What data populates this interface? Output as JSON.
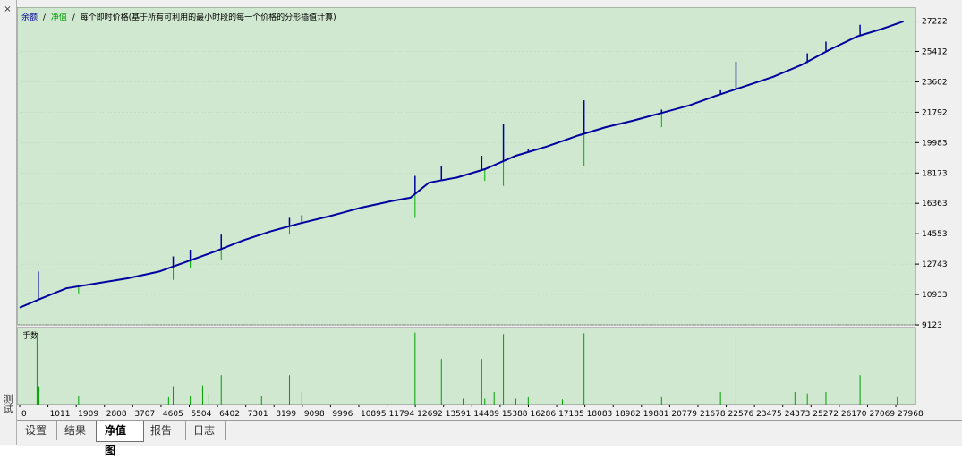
{
  "window": {
    "side_title": "测试",
    "close_glyph": "×"
  },
  "tabs": [
    {
      "label": "设置",
      "active": false
    },
    {
      "label": "结果",
      "active": false
    },
    {
      "label": "净值图",
      "active": true
    },
    {
      "label": "报告",
      "active": false
    },
    {
      "label": "日志",
      "active": false
    }
  ],
  "chart_data": [
    {
      "type": "line",
      "header": {
        "balance_label": "余额",
        "separator": "/",
        "equity_label": "净值",
        "note": "每个即时价格(基于所有可利用的最小时段的每一个价格的分形插值计算)"
      },
      "y_ticks": [
        27222,
        25412,
        23602,
        21792,
        19983,
        18173,
        16363,
        14553,
        12743,
        10933,
        9123
      ],
      "ylim": [
        9123,
        28050
      ],
      "xlim": [
        0,
        28800
      ],
      "colors": {
        "balance": "#0000a0",
        "equity": "#00b000",
        "background": "#cfe8cf",
        "grid": "#b4ccb4"
      },
      "series": [
        {
          "name": "余额",
          "x": [
            0,
            700,
            1500,
            2500,
            3500,
            4500,
            5400,
            6300,
            7200,
            8100,
            9000,
            10000,
            11000,
            12000,
            12600,
            13200,
            14100,
            15000,
            16000,
            17000,
            18000,
            18900,
            19800,
            20700,
            21600,
            22500,
            23400,
            24300,
            25200,
            26100,
            27000,
            27800,
            28500
          ],
          "y": [
            10150,
            10700,
            11300,
            11600,
            11900,
            12300,
            12900,
            13500,
            14150,
            14700,
            15150,
            15600,
            16100,
            16500,
            16700,
            17600,
            17900,
            18400,
            19200,
            19750,
            20400,
            20900,
            21300,
            21750,
            22200,
            22800,
            23350,
            23900,
            24600,
            25500,
            26300,
            26750,
            27200
          ]
        },
        {
          "name": "净值",
          "spikes": [
            {
              "x": 600,
              "y": 12300
            },
            {
              "x": 1900,
              "y": 11500
            },
            {
              "x": 4950,
              "y": 13200
            },
            {
              "x": 5500,
              "y": 13600
            },
            {
              "x": 6500,
              "y": 14500
            },
            {
              "x": 8700,
              "y": 15500
            },
            {
              "x": 9100,
              "y": 15650
            },
            {
              "x": 12750,
              "y": 18000
            },
            {
              "x": 13600,
              "y": 18600
            },
            {
              "x": 14900,
              "y": 19200
            },
            {
              "x": 15600,
              "y": 21100
            },
            {
              "x": 16400,
              "y": 19600
            },
            {
              "x": 18200,
              "y": 22500
            },
            {
              "x": 20700,
              "y": 21950
            },
            {
              "x": 22600,
              "y": 23100
            },
            {
              "x": 23100,
              "y": 24800
            },
            {
              "x": 25400,
              "y": 25300
            },
            {
              "x": 26000,
              "y": 26000
            },
            {
              "x": 27100,
              "y": 27000
            }
          ],
          "dips": [
            {
              "x": 1900,
              "y": 11000
            },
            {
              "x": 4950,
              "y": 11800
            },
            {
              "x": 5500,
              "y": 12500
            },
            {
              "x": 6500,
              "y": 13000
            },
            {
              "x": 8700,
              "y": 14500
            },
            {
              "x": 12750,
              "y": 15500
            },
            {
              "x": 15000,
              "y": 17700
            },
            {
              "x": 15600,
              "y": 17400
            },
            {
              "x": 18200,
              "y": 18600
            },
            {
              "x": 20700,
              "y": 20900
            },
            {
              "x": 25400,
              "y": 24700
            }
          ]
        }
      ]
    },
    {
      "type": "bar",
      "title": "手数",
      "x_ticks": [
        0,
        1011,
        1909,
        2808,
        3707,
        4605,
        5504,
        6402,
        7301,
        8199,
        9098,
        9996,
        10895,
        11794,
        12692,
        13591,
        14489,
        15388,
        16286,
        17185,
        18083,
        18982,
        19881,
        20779,
        21678,
        22576,
        23475,
        24373,
        25272,
        26170,
        27069,
        27968
      ],
      "ylim": [
        0,
        100
      ],
      "bars": [
        {
          "x": 560,
          "value": 92
        },
        {
          "x": 620,
          "value": 25
        },
        {
          "x": 1900,
          "value": 12
        },
        {
          "x": 4800,
          "value": 10
        },
        {
          "x": 4950,
          "value": 25
        },
        {
          "x": 5500,
          "value": 12
        },
        {
          "x": 5900,
          "value": 26
        },
        {
          "x": 6100,
          "value": 15
        },
        {
          "x": 6500,
          "value": 40
        },
        {
          "x": 7200,
          "value": 8
        },
        {
          "x": 7800,
          "value": 12
        },
        {
          "x": 8700,
          "value": 40
        },
        {
          "x": 9100,
          "value": 17
        },
        {
          "x": 12750,
          "value": 98
        },
        {
          "x": 13600,
          "value": 62
        },
        {
          "x": 14300,
          "value": 8
        },
        {
          "x": 14900,
          "value": 62
        },
        {
          "x": 15000,
          "value": 8
        },
        {
          "x": 15300,
          "value": 17
        },
        {
          "x": 15600,
          "value": 96
        },
        {
          "x": 16000,
          "value": 8
        },
        {
          "x": 16400,
          "value": 10
        },
        {
          "x": 17500,
          "value": 7
        },
        {
          "x": 18200,
          "value": 97
        },
        {
          "x": 20700,
          "value": 10
        },
        {
          "x": 22600,
          "value": 17
        },
        {
          "x": 23100,
          "value": 96
        },
        {
          "x": 25000,
          "value": 17
        },
        {
          "x": 25400,
          "value": 15
        },
        {
          "x": 26000,
          "value": 17
        },
        {
          "x": 27100,
          "value": 40
        },
        {
          "x": 28300,
          "value": 10
        }
      ],
      "color": "#00a000"
    }
  ]
}
